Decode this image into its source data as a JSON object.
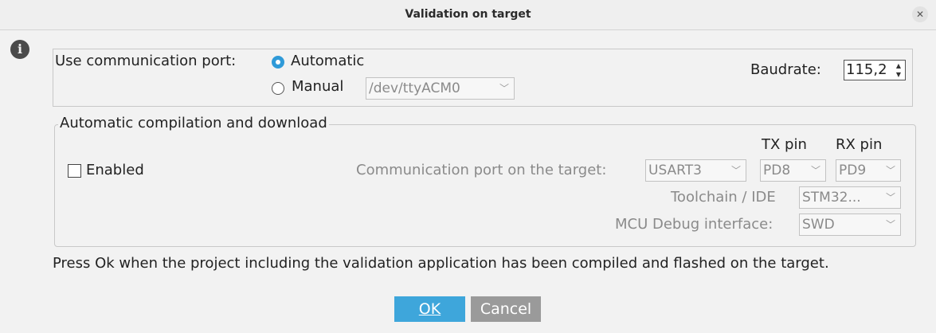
{
  "dialog": {
    "title": "Validation on target",
    "close_glyph": "✕",
    "info_glyph": "i"
  },
  "port": {
    "label": "Use communication port:",
    "automatic_label": "Automatic",
    "manual_label": "Manual",
    "selected": "Automatic",
    "device_value": "/dev/ttyACM0",
    "baudrate_label": "Baudrate:",
    "baudrate_value": "115,2"
  },
  "compilation": {
    "title": "Automatic compilation and download",
    "enabled_label": "Enabled",
    "enabled_checked": false,
    "tx_header": "TX pin",
    "rx_header": "RX pin",
    "comm_port_label": "Communication port on the target:",
    "comm_port_value": "USART3",
    "tx_value": "PD8",
    "rx_value": "PD9",
    "toolchain_label": "Toolchain / IDE",
    "toolchain_value": "STM32...",
    "debug_label": "MCU Debug interface:",
    "debug_value": "SWD"
  },
  "message": "Press Ok when the project including the validation application has been compiled and flashed on the target.",
  "buttons": {
    "ok": "OK",
    "cancel": "Cancel"
  },
  "colors": {
    "accent": "#3ea6db",
    "disabled_text": "#8a8a8a",
    "background": "#f2f2f2"
  },
  "icons": [
    "info-icon",
    "close-icon",
    "chevron-down-icon",
    "spinner-arrows-icon"
  ]
}
